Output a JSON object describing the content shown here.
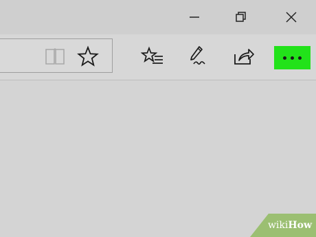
{
  "window_controls": {
    "minimize_icon": "minimize-icon",
    "restore_icon": "restore-icon",
    "close_icon": "close-icon"
  },
  "toolbar": {
    "reading_view_icon": "book-icon",
    "favorite_icon": "star-icon",
    "favorites_hub_icon": "star-list-icon",
    "web_note_icon": "pen-icon",
    "share_icon": "share-icon",
    "more_icon": "ellipsis-icon",
    "more_highlight_color": "#22e21a"
  },
  "watermark": {
    "prefix": "wiki",
    "suffix": "How"
  }
}
